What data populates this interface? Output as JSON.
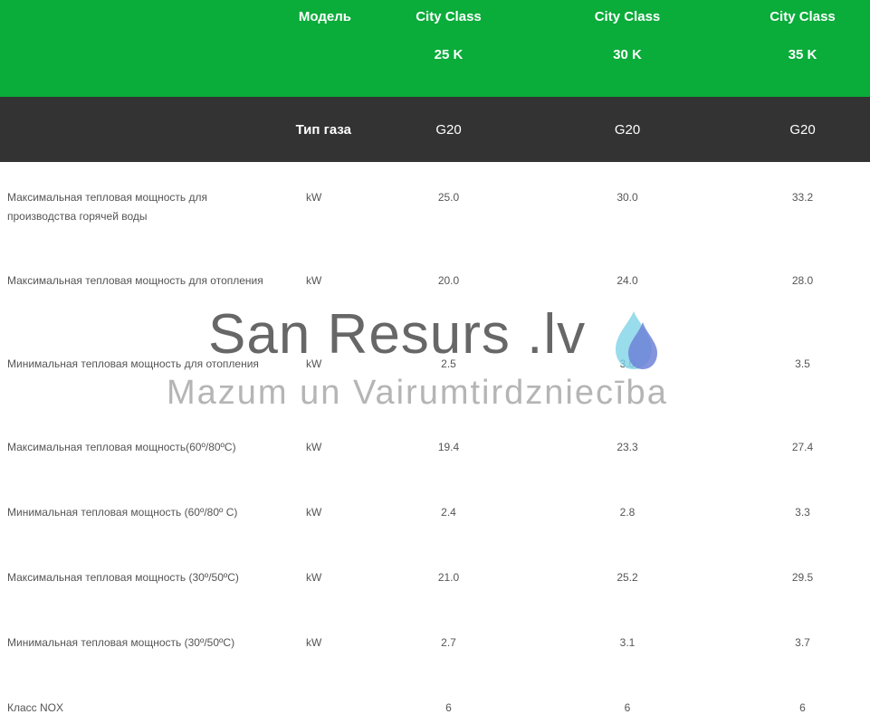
{
  "header": {
    "model_label": "Модель",
    "models": [
      {
        "line1": "City Class",
        "line2": "25 K"
      },
      {
        "line1": "City Class",
        "line2": "30 K"
      },
      {
        "line1": "City Class",
        "line2": "35 K"
      }
    ],
    "gas_label": "Тип газа",
    "gas_types": [
      "G20",
      "G20",
      "G20"
    ]
  },
  "rows": [
    {
      "name": "Максимальная тепловая мощность для производства горячей воды",
      "unit": "kW",
      "values": [
        "25.0",
        "30.0",
        "33.2"
      ]
    },
    {
      "name": "Максимальная тепловая мощность для отопления",
      "unit": "kW",
      "values": [
        "20.0",
        "24.0",
        "28.0"
      ]
    },
    {
      "name": "Минимальная тепловая мощность для отопления",
      "unit": "kW",
      "values": [
        "2.5",
        "3.0",
        "3.5"
      ]
    },
    {
      "name": "Максимальная тепловая мощность(60º/80ºC)",
      "unit": "kW",
      "values": [
        "19.4",
        "23.3",
        "27.4"
      ]
    },
    {
      "name": "Минимальная тепловая мощность (60º/80º C)",
      "unit": "kW",
      "values": [
        "2.4",
        "2.8",
        "3.3"
      ]
    },
    {
      "name": "Максимальная тепловая мощность (30º/50ºC)",
      "unit": "kW",
      "values": [
        "21.0",
        "25.2",
        "29.5"
      ]
    },
    {
      "name": "Минимальная тепловая мощность (30º/50ºC)",
      "unit": "kW",
      "values": [
        "2.7",
        "3.1",
        "3.7"
      ]
    },
    {
      "name": "Класс NOX",
      "unit": "",
      "values": [
        "6",
        "6",
        "6"
      ]
    }
  ],
  "watermark": {
    "title": "San Resurs .lv",
    "subtitle": "Mazum un Vairumtirdzniecība",
    "icon": "water-drop-icon"
  },
  "colors": {
    "header_green": "#0aac3a",
    "header_dark": "#333333",
    "body_text": "#555555",
    "drop_light": "#7fd3e6",
    "drop_dark": "#6f82d8"
  }
}
